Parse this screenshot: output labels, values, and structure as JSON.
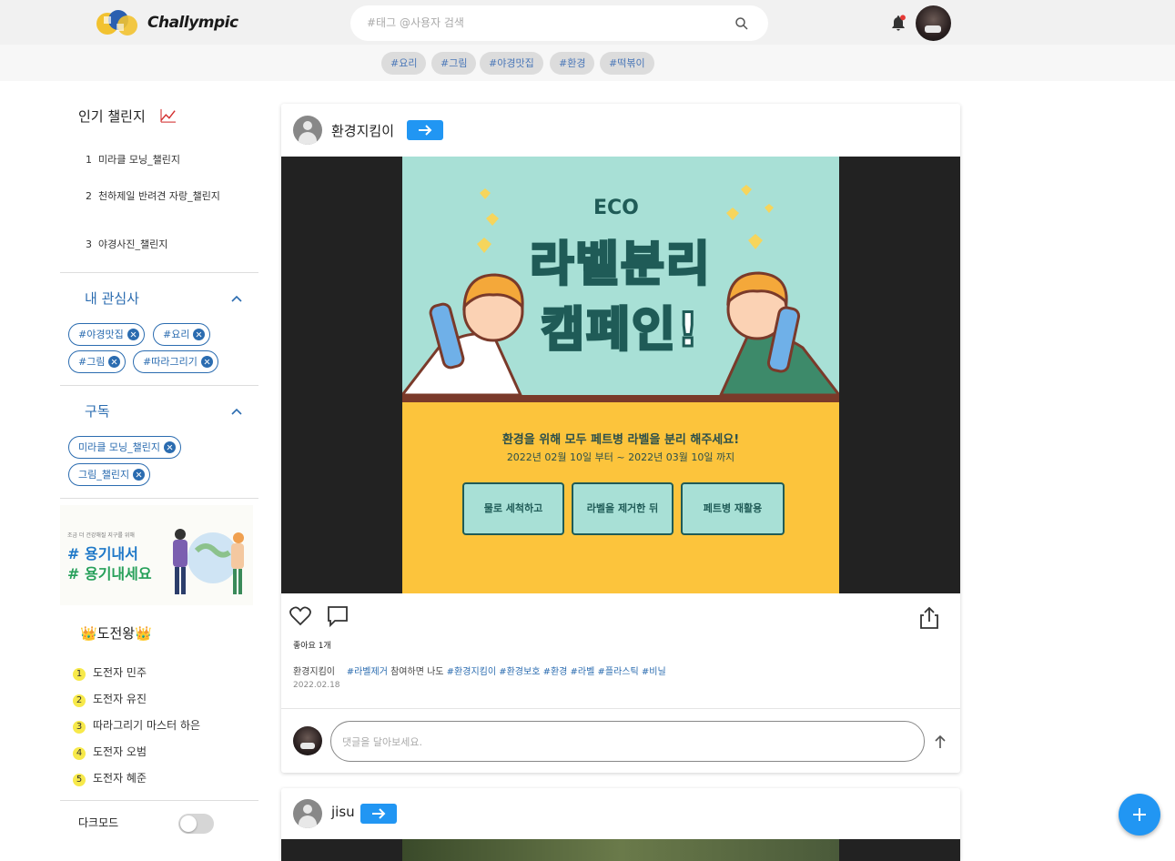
{
  "header": {
    "brand": "Challympic",
    "search_placeholder": "#태그 @사용자 검색"
  },
  "trending_tags": [
    "#요리",
    "#그림",
    "#야경맛집",
    "#환경",
    "#떡볶이"
  ],
  "sidebar": {
    "popular_title": "인기 챌린지",
    "popular": [
      {
        "rank": "1",
        "name": "미라클 모닝_챌린지"
      },
      {
        "rank": "2",
        "name": "천하제일 반려견 자랑_챌린지"
      },
      {
        "rank": "3",
        "name": "야경사진_챌린지"
      }
    ],
    "interests_title": "내 관심사",
    "interests": [
      "#야경맛집",
      "#요리",
      "#그림",
      "#따라그리기"
    ],
    "subscribe_title": "구독",
    "subscriptions": [
      "미라클 모닝_챌린지",
      "그림_챌린지"
    ],
    "banner": {
      "small": "조금 더 건강해질 지구를 위해",
      "line1": "# 용기내서",
      "line2": "# 용기내세요"
    },
    "champions_title": "👑도전왕👑",
    "champions": [
      {
        "rank": "1",
        "name": "도전자 민주"
      },
      {
        "rank": "2",
        "name": "도전자 유진"
      },
      {
        "rank": "3",
        "name": "따라그리기 마스터 하은"
      },
      {
        "rank": "4",
        "name": "도전자 오범"
      },
      {
        "rank": "5",
        "name": "도전자 혜준"
      }
    ],
    "dark_mode_label": "다크모드",
    "dark_mode_on": false
  },
  "posts": [
    {
      "author": "환경지킴이",
      "poster": {
        "eco": "ECO",
        "title1": "라벨분리",
        "title2": "캠페인!",
        "line1": "환경을 위해 모두 페트병 라벨을 분리 해주세요!",
        "line2": "2022년 02월 10일 부터 ~ 2022년 03월 10일 까지",
        "steps": [
          "물로 세척하고",
          "라벨을 제거한 뒤",
          "페트병 재활용"
        ]
      },
      "likes": "좋아요 1개",
      "caption_author": "환경지킴이",
      "caption_tag1": "#라벨제거",
      "caption_text": "참여하면 나도",
      "caption_tags": "#환경지킴이 #환경보호 #환경 #라벨 #플라스틱 #비닐",
      "date": "2022.02.18",
      "comment_placeholder": "댓글을 달아보세요."
    },
    {
      "author": "jisu"
    }
  ],
  "colors": {
    "accent": "#2196f3",
    "chip": "#2b6cb0",
    "poster_mint": "#a8e0d6",
    "poster_yellow": "#fcc43c"
  }
}
